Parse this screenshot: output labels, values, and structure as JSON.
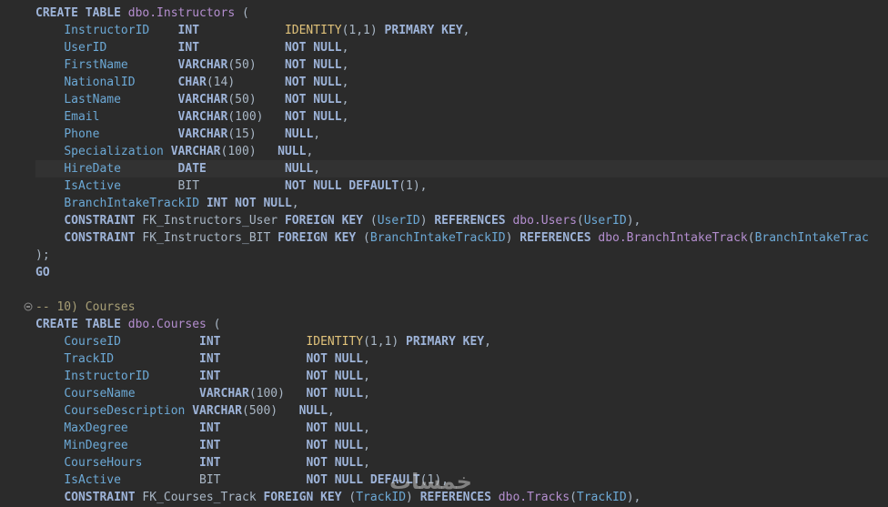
{
  "editor": {
    "highlighted_line": 9,
    "lines": [
      [
        [
          "kw",
          "CREATE TABLE "
        ],
        [
          "obj",
          "dbo.Instructors"
        ],
        [
          "p",
          " ("
        ]
      ],
      [
        [
          "p",
          "    "
        ],
        [
          "col",
          "InstructorID  "
        ],
        [
          "p",
          "  "
        ],
        [
          "ty",
          "INT"
        ],
        [
          "p",
          "            "
        ],
        [
          "fn",
          "IDENTITY"
        ],
        [
          "p",
          "(1,1) "
        ],
        [
          "kw",
          "PRIMARY KEY"
        ],
        [
          "p",
          ","
        ]
      ],
      [
        [
          "p",
          "    "
        ],
        [
          "col",
          "UserID        "
        ],
        [
          "p",
          "  "
        ],
        [
          "ty",
          "INT"
        ],
        [
          "p",
          "            "
        ],
        [
          "kw",
          "NOT NULL"
        ],
        [
          "p",
          ","
        ]
      ],
      [
        [
          "p",
          "    "
        ],
        [
          "col",
          "FirstName     "
        ],
        [
          "p",
          "  "
        ],
        [
          "ty",
          "VARCHAR"
        ],
        [
          "p",
          "(50)    "
        ],
        [
          "kw",
          "NOT NULL"
        ],
        [
          "p",
          ","
        ]
      ],
      [
        [
          "p",
          "    "
        ],
        [
          "col",
          "NationalID    "
        ],
        [
          "p",
          "  "
        ],
        [
          "ty",
          "CHAR"
        ],
        [
          "p",
          "(14)       "
        ],
        [
          "kw",
          "NOT NULL"
        ],
        [
          "p",
          ","
        ]
      ],
      [
        [
          "p",
          "    "
        ],
        [
          "col",
          "LastName      "
        ],
        [
          "p",
          "  "
        ],
        [
          "ty",
          "VARCHAR"
        ],
        [
          "p",
          "(50)    "
        ],
        [
          "kw",
          "NOT NULL"
        ],
        [
          "p",
          ","
        ]
      ],
      [
        [
          "p",
          "    "
        ],
        [
          "col",
          "Email         "
        ],
        [
          "p",
          "  "
        ],
        [
          "ty",
          "VARCHAR"
        ],
        [
          "p",
          "(100)   "
        ],
        [
          "kw",
          "NOT NULL"
        ],
        [
          "p",
          ","
        ]
      ],
      [
        [
          "p",
          "    "
        ],
        [
          "col",
          "Phone         "
        ],
        [
          "p",
          "  "
        ],
        [
          "ty",
          "VARCHAR"
        ],
        [
          "p",
          "(15)    "
        ],
        [
          "kw",
          "NULL"
        ],
        [
          "p",
          ","
        ]
      ],
      [
        [
          "p",
          "    "
        ],
        [
          "col",
          "Specialization"
        ],
        [
          "p",
          " "
        ],
        [
          "ty",
          "VARCHAR"
        ],
        [
          "p",
          "(100)   "
        ],
        [
          "kw",
          "NULL"
        ],
        [
          "p",
          ","
        ]
      ],
      [
        [
          "p",
          "    "
        ],
        [
          "col",
          "HireDate      "
        ],
        [
          "p",
          "  "
        ],
        [
          "ty",
          "DATE"
        ],
        [
          "p",
          "           "
        ],
        [
          "kw",
          "NULL"
        ],
        [
          "p",
          ","
        ]
      ],
      [
        [
          "p",
          "    "
        ],
        [
          "col",
          "IsActive      "
        ],
        [
          "p",
          "  "
        ],
        [
          "ty2",
          "BIT"
        ],
        [
          "p",
          "            "
        ],
        [
          "kw",
          "NOT NULL DEFAULT"
        ],
        [
          "p",
          "(1),"
        ]
      ],
      [
        [
          "p",
          "    "
        ],
        [
          "col",
          "BranchIntakeTrackID"
        ],
        [
          "p",
          " "
        ],
        [
          "kw",
          "INT NOT NULL"
        ],
        [
          "p",
          ","
        ]
      ],
      [
        [
          "p",
          "    "
        ],
        [
          "kw",
          "CONSTRAINT"
        ],
        [
          "p",
          " FK_Instructors_User "
        ],
        [
          "kw",
          "FOREIGN KEY"
        ],
        [
          "p",
          " ("
        ],
        [
          "col",
          "UserID"
        ],
        [
          "p",
          ") "
        ],
        [
          "kw",
          "REFERENCES"
        ],
        [
          "p",
          " "
        ],
        [
          "obj",
          "dbo.Users"
        ],
        [
          "p",
          "("
        ],
        [
          "col",
          "UserID"
        ],
        [
          "p",
          "),"
        ]
      ],
      [
        [
          "p",
          "    "
        ],
        [
          "kw",
          "CONSTRAINT"
        ],
        [
          "p",
          " FK_Instructors_BIT "
        ],
        [
          "kw",
          "FOREIGN KEY"
        ],
        [
          "p",
          " ("
        ],
        [
          "col",
          "BranchIntakeTrackID"
        ],
        [
          "p",
          ") "
        ],
        [
          "kw",
          "REFERENCES"
        ],
        [
          "p",
          " "
        ],
        [
          "obj",
          "dbo.BranchIntakeTrack"
        ],
        [
          "p",
          "("
        ],
        [
          "col",
          "BranchIntakeTrac"
        ]
      ],
      [
        [
          "p",
          ");"
        ]
      ],
      [
        [
          "kw",
          "GO"
        ]
      ],
      [
        [
          "p",
          ""
        ]
      ],
      [
        [
          "cm",
          "-- 10) Courses"
        ]
      ],
      [
        [
          "kw",
          "CREATE TABLE "
        ],
        [
          "obj",
          "dbo.Courses"
        ],
        [
          "p",
          " ("
        ]
      ],
      [
        [
          "p",
          "    "
        ],
        [
          "col",
          "CourseID         "
        ],
        [
          "p",
          "  "
        ],
        [
          "ty",
          "INT"
        ],
        [
          "p",
          "            "
        ],
        [
          "fn",
          "IDENTITY"
        ],
        [
          "p",
          "(1,1) "
        ],
        [
          "kw",
          "PRIMARY KEY"
        ],
        [
          "p",
          ","
        ]
      ],
      [
        [
          "p",
          "    "
        ],
        [
          "col",
          "TrackID          "
        ],
        [
          "p",
          "  "
        ],
        [
          "ty",
          "INT"
        ],
        [
          "p",
          "            "
        ],
        [
          "kw",
          "NOT NULL"
        ],
        [
          "p",
          ","
        ]
      ],
      [
        [
          "p",
          "    "
        ],
        [
          "col",
          "InstructorID     "
        ],
        [
          "p",
          "  "
        ],
        [
          "ty",
          "INT"
        ],
        [
          "p",
          "            "
        ],
        [
          "kw",
          "NOT NULL"
        ],
        [
          "p",
          ","
        ]
      ],
      [
        [
          "p",
          "    "
        ],
        [
          "col",
          "CourseName       "
        ],
        [
          "p",
          "  "
        ],
        [
          "ty",
          "VARCHAR"
        ],
        [
          "p",
          "(100)   "
        ],
        [
          "kw",
          "NOT NULL"
        ],
        [
          "p",
          ","
        ]
      ],
      [
        [
          "p",
          "    "
        ],
        [
          "col",
          "CourseDescription"
        ],
        [
          "p",
          " "
        ],
        [
          "ty",
          "VARCHAR"
        ],
        [
          "p",
          "(500)   "
        ],
        [
          "kw",
          "NULL"
        ],
        [
          "p",
          ","
        ]
      ],
      [
        [
          "p",
          "    "
        ],
        [
          "col",
          "MaxDegree        "
        ],
        [
          "p",
          "  "
        ],
        [
          "ty",
          "INT"
        ],
        [
          "p",
          "            "
        ],
        [
          "kw",
          "NOT NULL"
        ],
        [
          "p",
          ","
        ]
      ],
      [
        [
          "p",
          "    "
        ],
        [
          "col",
          "MinDegree        "
        ],
        [
          "p",
          "  "
        ],
        [
          "ty",
          "INT"
        ],
        [
          "p",
          "            "
        ],
        [
          "kw",
          "NOT NULL"
        ],
        [
          "p",
          ","
        ]
      ],
      [
        [
          "p",
          "    "
        ],
        [
          "col",
          "CourseHours      "
        ],
        [
          "p",
          "  "
        ],
        [
          "ty",
          "INT"
        ],
        [
          "p",
          "            "
        ],
        [
          "kw",
          "NOT NULL"
        ],
        [
          "p",
          ","
        ]
      ],
      [
        [
          "p",
          "    "
        ],
        [
          "col",
          "IsActive         "
        ],
        [
          "p",
          "  "
        ],
        [
          "ty2",
          "BIT"
        ],
        [
          "p",
          "            "
        ],
        [
          "kw",
          "NOT NULL DEFAULT"
        ],
        [
          "p",
          "(1),"
        ]
      ],
      [
        [
          "p",
          "    "
        ],
        [
          "kw",
          "CONSTRAINT"
        ],
        [
          "p",
          " FK_Courses_Track "
        ],
        [
          "kw",
          "FOREIGN KEY"
        ],
        [
          "p",
          " ("
        ],
        [
          "col",
          "TrackID"
        ],
        [
          "p",
          ") "
        ],
        [
          "kw",
          "REFERENCES"
        ],
        [
          "p",
          " "
        ],
        [
          "obj",
          "dbo.Tracks"
        ],
        [
          "p",
          "("
        ],
        [
          "col",
          "TrackID"
        ],
        [
          "p",
          "),"
        ]
      ]
    ],
    "fold_line": 17,
    "watermark": "خمسات"
  }
}
